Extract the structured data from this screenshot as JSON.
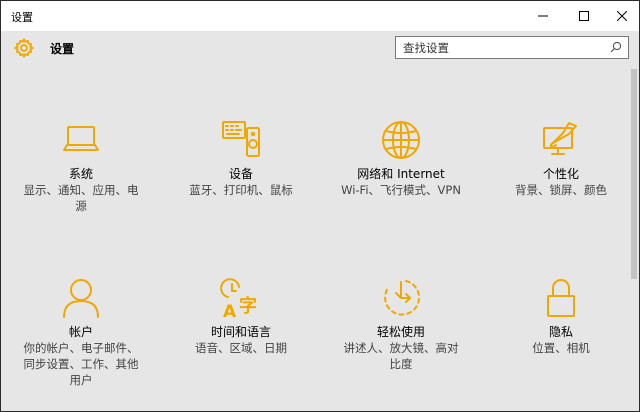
{
  "window": {
    "title": "设置",
    "controls": {
      "minimize": "minimize",
      "maximize": "maximize",
      "close": "close"
    }
  },
  "header": {
    "title": "设置",
    "search_placeholder": "查找设置"
  },
  "accent_color": "#f0a800",
  "tiles": [
    {
      "icon": "laptop-icon",
      "name": "系统",
      "desc_lines": [
        "显示、通知、应用、电",
        "源"
      ]
    },
    {
      "icon": "devices-icon",
      "name": "设备",
      "desc_lines": [
        "蓝牙、打印机、鼠标"
      ]
    },
    {
      "icon": "globe-icon",
      "name": "网络和 Internet",
      "desc_lines": [
        "Wi-Fi、飞行模式、VPN"
      ]
    },
    {
      "icon": "personalization-icon",
      "name": "个性化",
      "desc_lines": [
        "背景、锁屏、颜色"
      ]
    },
    {
      "icon": "person-icon",
      "name": "帐户",
      "desc_lines": [
        "你的帐户、电子邮件、",
        "同步设置、工作、其他",
        "用户"
      ]
    },
    {
      "icon": "time-language-icon",
      "name": "时间和语言",
      "desc_lines": [
        "语音、区域、日期"
      ]
    },
    {
      "icon": "ease-of-access-icon",
      "name": "轻松使用",
      "desc_lines": [
        "讲述人、放大镜、高对",
        "比度"
      ]
    },
    {
      "icon": "lock-icon",
      "name": "隐私",
      "desc_lines": [
        "位置、相机"
      ]
    }
  ]
}
